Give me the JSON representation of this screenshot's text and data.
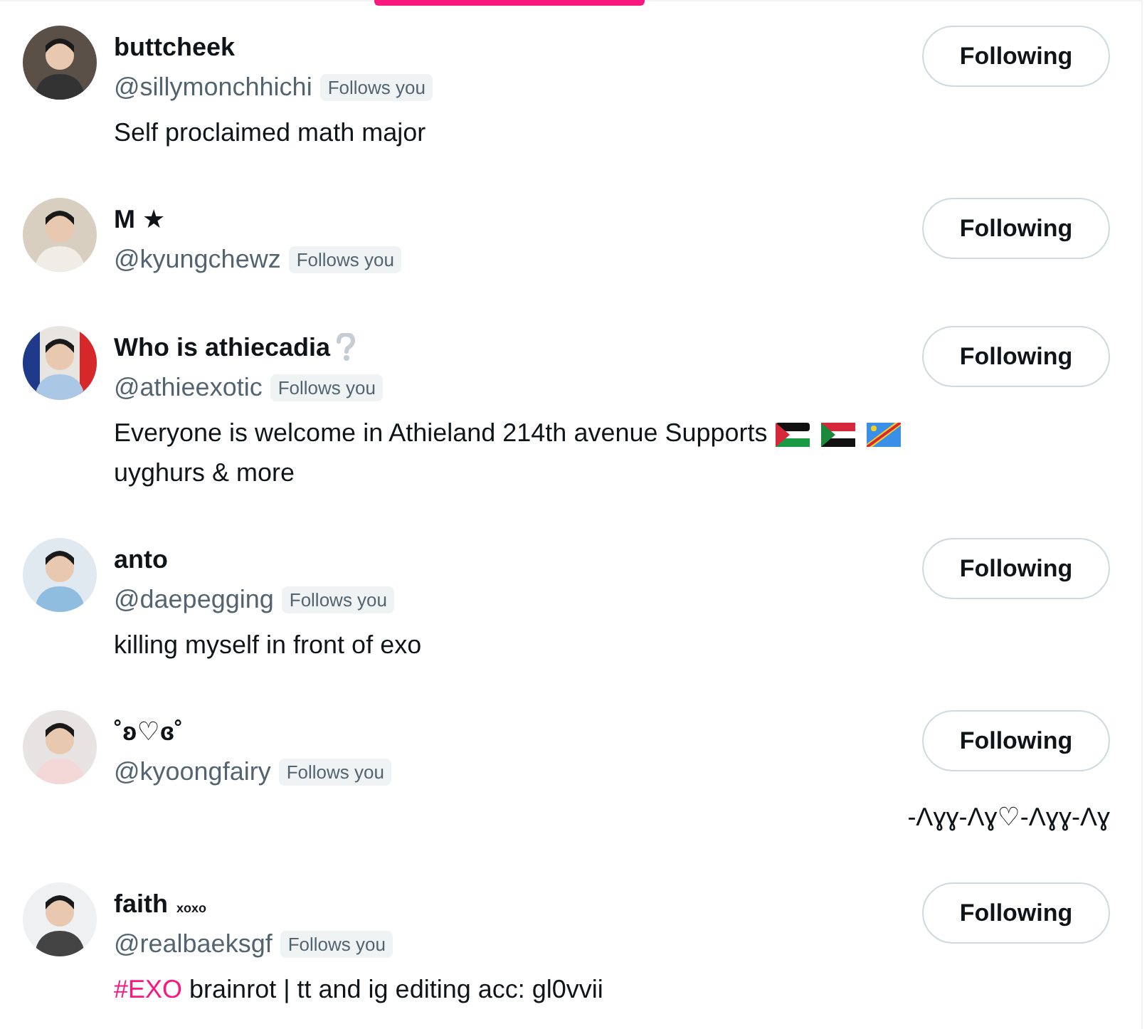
{
  "tab_indicator": {
    "selected": true
  },
  "users": [
    {
      "name": "buttcheek",
      "handle": "@sillymonchhichi",
      "follows_you": "Follows you",
      "bio": "Self proclaimed math major",
      "button": "Following"
    },
    {
      "name": "M ★",
      "handle": "@kyungchewz",
      "follows_you": "Follows you",
      "button": "Following"
    },
    {
      "name": "Who is athiecadia",
      "name_badge": true,
      "handle": "@athieexotic",
      "follows_you": "Follows you",
      "bio": "Everyone is welcome in Athieland 214th avenue Supports",
      "bio_flags": true,
      "bio_more": "uyghurs & more",
      "button": "Following"
    },
    {
      "name": "anto",
      "handle": "@daepegging",
      "follows_you": "Follows you",
      "bio": "killing myself in front of exo",
      "button": "Following"
    },
    {
      "name": "˚ʚ♡ɞ˚",
      "handle": "@kyoongfairy",
      "follows_you": "Follows you",
      "bio": "-Λɣɣ-Λɣ♡-Λɣɣ-Λɣ",
      "bio_right": true,
      "button": "Following"
    },
    {
      "name": "faith",
      "name_suffix": "xoxo",
      "handle": "@realbaeksgf",
      "follows_you": "Follows you",
      "bio_hashtag": "#EXO",
      "bio": "brainrot | tt and ig editing acc: gl0vvii",
      "button": "Following"
    }
  ]
}
